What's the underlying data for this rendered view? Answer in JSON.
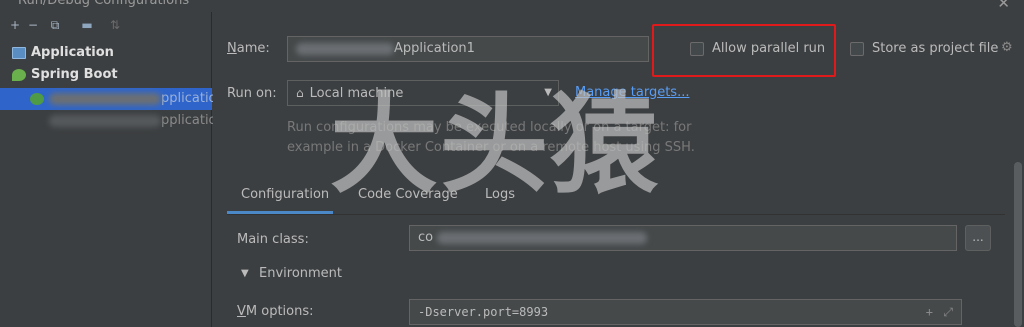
{
  "window": {
    "title": "Run/Debug Configurations",
    "close_icon": "close-icon"
  },
  "toolbar": {
    "icons": [
      "add-icon",
      "remove-icon",
      "copy-icon",
      "folder-add-icon",
      "sort-icon"
    ],
    "add_glyph": "+",
    "remove_glyph": "−",
    "copy_glyph": "⧉",
    "folder_glyph": "▬",
    "sort_glyph": "⇅"
  },
  "tree": {
    "application": "Application",
    "spring_boot": "Spring Boot",
    "selected_item_suffix": "pplicatio",
    "second_item_suffix": "pplicatio"
  },
  "form": {
    "name_label": "Name:",
    "name_value": "Application1",
    "allow_parallel_run": "Allow parallel run",
    "allow_parallel_run_checked": false,
    "store_as_project_file": "Store as project file",
    "store_as_project_file_checked": false,
    "run_on_label": "Run on:",
    "run_on_value": "Local machine",
    "manage_targets": "Manage targets...",
    "hint_line1": "Run configurations may be executed locally or on a target: for",
    "hint_line2": "example in a Docker Container or on a remote host using SSH."
  },
  "tabs": [
    {
      "label": "Configuration",
      "active": true
    },
    {
      "label": "Code Coverage",
      "active": false
    },
    {
      "label": "Logs",
      "active": false
    }
  ],
  "configuration": {
    "main_class_label": "Main class:",
    "main_class_prefix": "co",
    "browse_button": "...",
    "environment_label": "Environment",
    "vm_options_label": "VM options:",
    "vm_options_value": "-Dserver.port=8993"
  },
  "watermark": "大头猿",
  "colors": {
    "background": "#3c3f41",
    "selection": "#2f65ca",
    "link": "#589df6",
    "highlight_border": "#e0191b",
    "tab_underline": "#4a88c7"
  }
}
